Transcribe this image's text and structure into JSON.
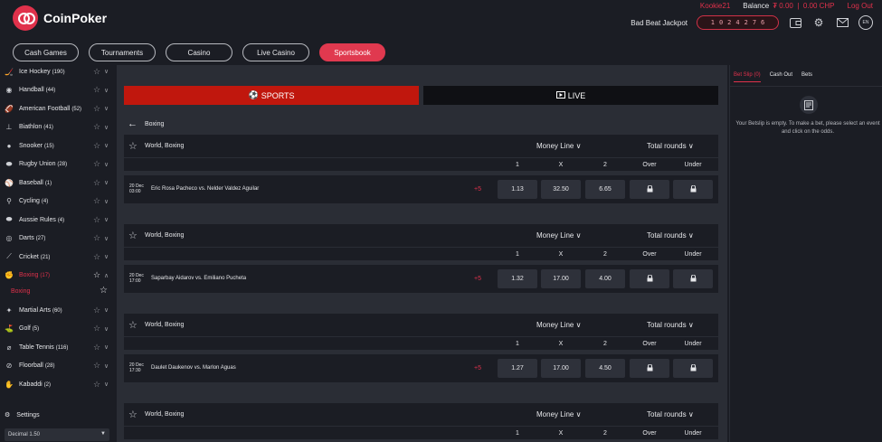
{
  "header": {
    "brand": "CoinPoker",
    "username": "Kookie21",
    "balance_label": "Balance",
    "balance_value": "₮ 0.00  |  0.00 CHP",
    "logout": "Log Out",
    "jackpot_label": "Bad Beat Jackpot",
    "jackpot_digits": [
      "1",
      "0",
      "2",
      "4",
      "2",
      "7",
      "6"
    ],
    "lang": "EN"
  },
  "nav": [
    {
      "label": "Cash Games"
    },
    {
      "label": "Tournaments"
    },
    {
      "label": "Casino"
    },
    {
      "label": "Live Casino"
    },
    {
      "label": "Sportsbook",
      "active": true
    }
  ],
  "sidebar": {
    "items": [
      {
        "label": "Ice Hockey",
        "count": "(190)",
        "icon": "hockey-icon"
      },
      {
        "label": "Handball",
        "count": "(44)",
        "icon": "handball-icon"
      },
      {
        "label": "American Football",
        "count": "(52)",
        "icon": "football-icon"
      },
      {
        "label": "Biathlon",
        "count": "(41)",
        "icon": "biathlon-icon"
      },
      {
        "label": "Snooker",
        "count": "(15)",
        "icon": "snooker-icon"
      },
      {
        "label": "Rugby Union",
        "count": "(28)",
        "icon": "rugby-icon"
      },
      {
        "label": "Baseball",
        "count": "(1)",
        "icon": "baseball-icon"
      },
      {
        "label": "Cycling",
        "count": "(4)",
        "icon": "cycling-icon"
      },
      {
        "label": "Aussie Rules",
        "count": "(4)",
        "icon": "aussie-rules-icon"
      },
      {
        "label": "Darts",
        "count": "(27)",
        "icon": "darts-icon"
      },
      {
        "label": "Cricket",
        "count": "(21)",
        "icon": "cricket-icon"
      },
      {
        "label": "Boxing",
        "count": "(17)",
        "icon": "boxing-icon",
        "active": true
      },
      {
        "label": "Martial Arts",
        "count": "(60)",
        "icon": "martial-arts-icon"
      },
      {
        "label": "Golf",
        "count": "(5)",
        "icon": "golf-icon"
      },
      {
        "label": "Table Tennis",
        "count": "(116)",
        "icon": "table-tennis-icon"
      },
      {
        "label": "Floorball",
        "count": "(28)",
        "icon": "floorball-icon"
      },
      {
        "label": "Kabaddi",
        "count": "(2)",
        "icon": "kabaddi-icon"
      }
    ],
    "sub_item": "Boxing",
    "settings": "Settings",
    "odds_format": "Decimal 1.50"
  },
  "main": {
    "tab_sports": "SPORTS",
    "tab_live": "LIVE",
    "breadcrumb": "Boxing",
    "events": [
      {
        "league": "World, Boxing",
        "market1": "Money Line",
        "market2": "Total rounds",
        "cols": [
          "1",
          "X",
          "2",
          "Over",
          "Under"
        ],
        "date": "20 Dec",
        "time": "03:00",
        "home": "Eric Rosa Pacheco",
        "vs": "vs.",
        "away": "Nelder Valdez Aguilar",
        "more": "+5",
        "odds": [
          "1.13",
          "32.50",
          "6.65"
        ]
      },
      {
        "league": "World, Boxing",
        "market1": "Money Line",
        "market2": "Total rounds",
        "cols": [
          "1",
          "X",
          "2",
          "Over",
          "Under"
        ],
        "date": "20 Dec",
        "time": "17:00",
        "home": "Saparbay Aidarov",
        "vs": "vs.",
        "away": "Emiliano Pucheta",
        "more": "+5",
        "odds": [
          "1.32",
          "17.00",
          "4.00"
        ]
      },
      {
        "league": "World, Boxing",
        "market1": "Money Line",
        "market2": "Total rounds",
        "cols": [
          "1",
          "X",
          "2",
          "Over",
          "Under"
        ],
        "date": "20 Dec",
        "time": "17:30",
        "home": "Daulet Daukenov",
        "vs": "vs.",
        "away": "Marlon Aguas",
        "more": "+5",
        "odds": [
          "1.27",
          "17.00",
          "4.50"
        ]
      },
      {
        "league": "World, Boxing",
        "market1": "Money Line",
        "market2": "Total rounds",
        "cols": [
          "1",
          "X",
          "2",
          "Over",
          "Under"
        ]
      }
    ]
  },
  "betslip": {
    "tabs": [
      "Bet Slip (0)",
      "Cash Out",
      "Bets"
    ],
    "empty_text": "Your Betslip is empty. To make a bet, please select an event and click on the odds."
  },
  "colors": {
    "accent": "#e0314b",
    "sports_tab": "#c0170d",
    "background": "#1b1d24",
    "panel": "#2a2d35"
  }
}
